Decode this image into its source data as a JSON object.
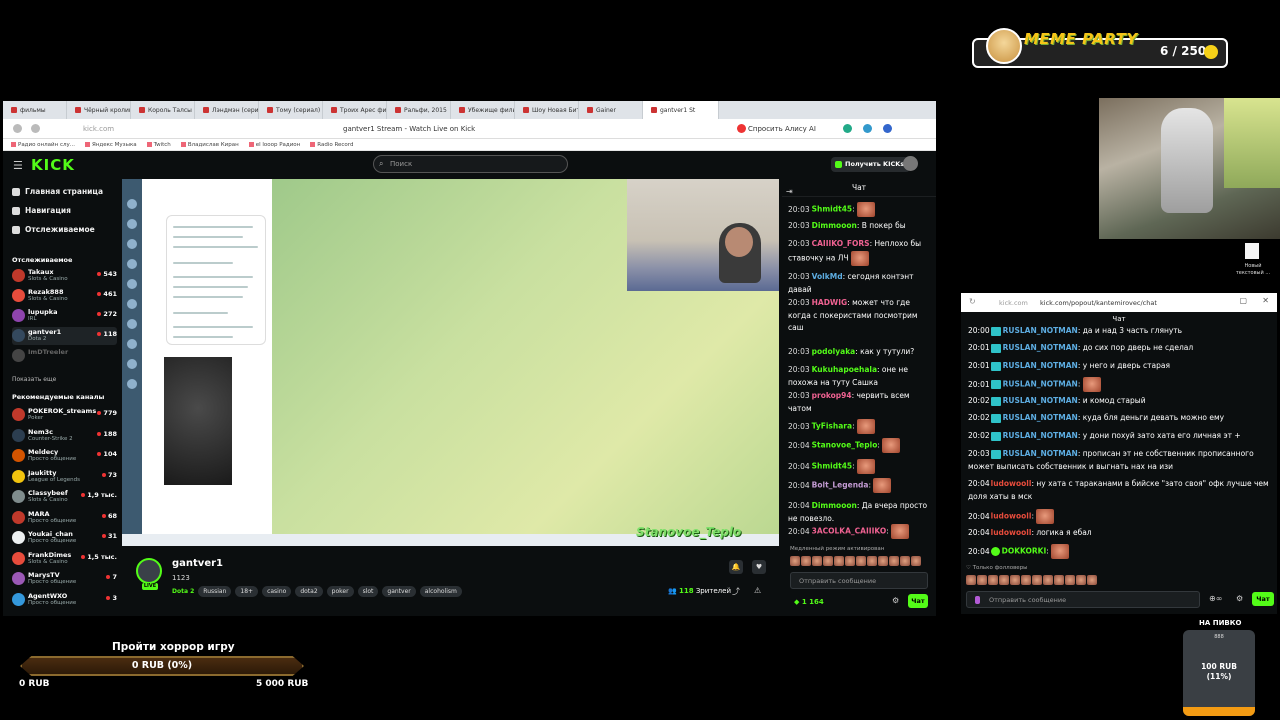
{
  "meme": {
    "title": "MEME PARTY",
    "count": "6 / 250"
  },
  "browser": {
    "tabs": [
      "фильмы",
      "Чёрный кролик",
      "Король Талсы",
      "Лэндмэн (сериал)",
      "Тому (сериал)",
      "Троих Арес фильм",
      "Ральфи, 2015",
      "Убежище фильм",
      "Шоу Новая Битва",
      "Gainer",
      "gantver1 St"
    ],
    "url": "kick.com",
    "page_title": "gantver1 Stream - Watch Live on Kick",
    "alice": "Спросить Алису AI",
    "bookmarks": [
      "Радио онлайн слу...",
      "Яндекс Музыка",
      "Twitch",
      "Владислав Киран",
      "el looop Радион",
      "Radio Record"
    ]
  },
  "kick": {
    "logo": "KICK",
    "search_placeholder": "Поиск",
    "get_kicks": "Получить KICKs"
  },
  "sidebar": {
    "nav": [
      "Главная страница",
      "Навигация",
      "Отслеживаемое"
    ],
    "followed_title": "Отслеживаемое",
    "followed": [
      {
        "name": "Takaux",
        "category": "Slots & Casino",
        "viewers": "543",
        "color": "#c0392b"
      },
      {
        "name": "Rezak888",
        "category": "Slots & Casino",
        "viewers": "461",
        "color": "#e74c3c"
      },
      {
        "name": "lupupka",
        "category": "IRL",
        "viewers": "272",
        "color": "#8e44ad"
      },
      {
        "name": "gantver1",
        "category": "Dota 2",
        "viewers": "118",
        "color": "#34495e"
      },
      {
        "name": "ImDTreeler",
        "category": "",
        "viewers": "",
        "color": "#444"
      }
    ],
    "show_more": "Показать еще",
    "recommended_title": "Рекомендуемые каналы",
    "recommended": [
      {
        "name": "POKEROK_streams",
        "category": "Poker",
        "viewers": "779",
        "color": "#c0392b"
      },
      {
        "name": "Nem3c",
        "category": "Counter-Strike 2",
        "viewers": "188",
        "color": "#2c3e50"
      },
      {
        "name": "Meldecy",
        "category": "Просто общение",
        "viewers": "104",
        "color": "#d35400"
      },
      {
        "name": "Jaukitty",
        "category": "League of Legends",
        "viewers": "73",
        "color": "#f1c40f"
      },
      {
        "name": "Classybeef",
        "category": "Slots & Casino",
        "viewers": "1,9 тыс.",
        "color": "#7f8c8d"
      },
      {
        "name": "MARA",
        "category": "Просто общение",
        "viewers": "68",
        "color": "#c0392b"
      },
      {
        "name": "Youkai_chan",
        "category": "Просто общение",
        "viewers": "31",
        "color": "#ecf0f1"
      },
      {
        "name": "FrankDimes",
        "category": "Slots & Casino",
        "viewers": "1,5 тыс.",
        "color": "#e74c3c"
      },
      {
        "name": "MarysTV",
        "category": "Просто общение",
        "viewers": "7",
        "color": "#9b59b6"
      },
      {
        "name": "AgentWXO",
        "category": "Просто общение",
        "viewers": "3",
        "color": "#3498db"
      }
    ]
  },
  "player": {
    "overlay_name": "Stanovoe_Teplo"
  },
  "stream": {
    "name": "gantver1",
    "title": "1123",
    "game": "Dota 2",
    "tags": [
      "Russian",
      "18+",
      "casino",
      "dota2",
      "poker",
      "slot",
      "gantver",
      "alcoholism"
    ],
    "viewers": "118",
    "viewers_label": "Зрителей",
    "live": "LIVE"
  },
  "chat": {
    "title": "Чат",
    "messages": [
      {
        "time": "20:03",
        "user": "Shmidt45",
        "color": "#53fc18",
        "text": ":",
        "emote": true
      },
      {
        "time": "20:03",
        "user": "Dimmooon",
        "color": "#53fc18",
        "text": ": В покер бы",
        "emote": false
      },
      {
        "time": "20:03",
        "user": "CAIIIKO_FORS",
        "color": "#f06292",
        "text": ": Неплохо бы ставочку на ЛЧ",
        "emote": true
      },
      {
        "time": "20:03",
        "user": "VolkMd",
        "color": "#5dade2",
        "text": ": сегодня контэнт давай",
        "emote": false
      },
      {
        "time": "20:03",
        "user": "HADWIG",
        "color": "#f06292",
        "text": ": может что где когда с покеристами посмотрим саш",
        "emote": false
      },
      {
        "time": "20:03",
        "user": "podolyaka",
        "color": "#53fc18",
        "text": ": как у тутули?",
        "emote": false
      },
      {
        "time": "20:03",
        "user": "Kukuhapoehala",
        "color": "#53fc18",
        "text": ": оне не похожа на туту Сашка",
        "emote": false
      },
      {
        "time": "20:03",
        "user": "prokop94",
        "color": "#f06292",
        "text": ": червить всем чатом",
        "emote": false
      },
      {
        "time": "20:03",
        "user": "TyFishara",
        "color": "#53fc18",
        "text": ":",
        "emote": true
      },
      {
        "time": "20:04",
        "user": "Stanovoe_Teplo",
        "color": "#53fc18",
        "text": ":",
        "emote": true
      },
      {
        "time": "20:04",
        "user": "Shmidt45",
        "color": "#53fc18",
        "text": ":",
        "emote": true
      },
      {
        "time": "20:04",
        "user": "Bolt_Legenda",
        "color": "#c39bd3",
        "text": ":",
        "emote": true
      },
      {
        "time": "20:04",
        "user": "Dimmooon",
        "color": "#53fc18",
        "text": ": Да вчера просто не повезло.",
        "emote": false
      },
      {
        "time": "20:04",
        "user": "3ACOLKA_CAIIIKO",
        "color": "#f06292",
        "text": ":",
        "emote": true
      }
    ],
    "slow_mode": "Медленный режим активирован",
    "send_placeholder": "Отправить сообщение",
    "kicks": "1 164",
    "chat_button": "Чат"
  },
  "desktop": {
    "file_label": "Новый текстовый ..."
  },
  "popout": {
    "domain": "kick.com",
    "path": "kick.com/popout/kantemirovec/chat",
    "title": "Чат",
    "messages": [
      {
        "time": "20:00",
        "user": "RUSLAN_NOTMAN",
        "color": "#5dade2",
        "badge": "sub",
        "text": ": да и над 3 часть глянуть",
        "emote": false
      },
      {
        "time": "20:01",
        "user": "RUSLAN_NOTMAN",
        "color": "#5dade2",
        "badge": "sub",
        "text": ": до сих пор дверь не сделал",
        "emote": false
      },
      {
        "time": "20:01",
        "user": "RUSLAN_NOTMAN",
        "color": "#5dade2",
        "badge": "sub",
        "text": ": у него и дверь старая",
        "emote": false
      },
      {
        "time": "20:01",
        "user": "RUSLAN_NOTMAN",
        "color": "#5dade2",
        "badge": "sub",
        "text": ":",
        "emote": true
      },
      {
        "time": "20:02",
        "user": "RUSLAN_NOTMAN",
        "color": "#5dade2",
        "badge": "sub",
        "text": ": и комод старый",
        "emote": false
      },
      {
        "time": "20:02",
        "user": "RUSLAN_NOTMAN",
        "color": "#5dade2",
        "badge": "sub",
        "text": ": куда бля деньги девать можно ему",
        "emote": false
      },
      {
        "time": "20:02",
        "user": "RUSLAN_NOTMAN",
        "color": "#5dade2",
        "badge": "sub",
        "text": ": у дони похуй зато хата его личная эт +",
        "emote": false
      },
      {
        "time": "20:03",
        "user": "RUSLAN_NOTMAN",
        "color": "#5dade2",
        "badge": "sub",
        "text": ": прописан эт не собственник прописанного может выписать собственник и выгнать нах на изи",
        "emote": false
      },
      {
        "time": "20:04",
        "user": "ludowooll",
        "color": "#e74c3c",
        "badge": "",
        "text": ": ну хата с тараканами в бийске \"зато своя\" офк лучше чем доля хаты в мск",
        "emote": false
      },
      {
        "time": "20:04",
        "user": "ludowooll",
        "color": "#e74c3c",
        "badge": "",
        "text": ":",
        "emote": true
      },
      {
        "time": "20:04",
        "user": "ludowooll",
        "color": "#e74c3c",
        "badge": "",
        "text": ": логика я ебал",
        "emote": false
      },
      {
        "time": "20:04",
        "user": "DOKKORKI",
        "color": "#53fc18",
        "badge": "verified",
        "text": ":",
        "emote": true
      }
    ],
    "followers_only": "Только фолловеры",
    "send_placeholder": "Отправить сообщение",
    "chat_button": "Чат"
  },
  "goal": {
    "title": "Пройти хоррор игру",
    "value": "0 RUB (0%)",
    "min": "0 RUB",
    "max": "5 000 RUB"
  },
  "beer": {
    "title": "НА ПИВКО",
    "small": "888",
    "amount": "100 RUB",
    "percent": "(11%)"
  }
}
